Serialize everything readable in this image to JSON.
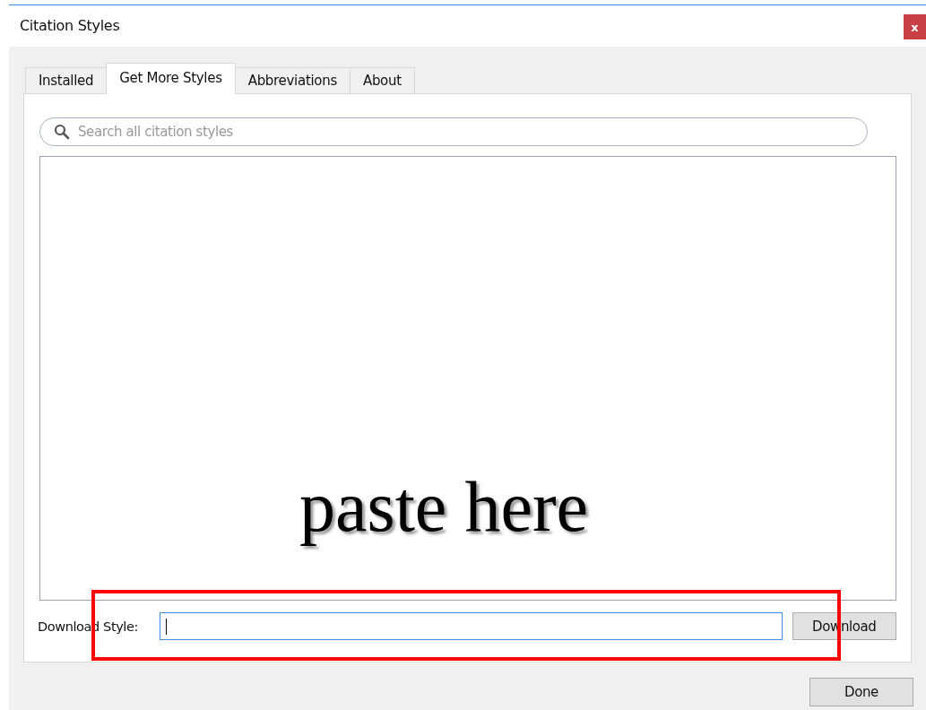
{
  "window": {
    "title": "Citation Styles",
    "close": "x"
  },
  "tabs": [
    {
      "label": "Installed",
      "selected": false
    },
    {
      "label": "Get More Styles",
      "selected": true
    },
    {
      "label": "Abbreviations",
      "selected": false
    },
    {
      "label": "About",
      "selected": false
    }
  ],
  "search": {
    "placeholder": "Search all citation styles"
  },
  "download": {
    "label": "Download Style:",
    "focused": true,
    "button": "Download"
  },
  "buttons": [
    "Done"
  ],
  "annotation": {
    "text": "paste here",
    "highlighted": true
  }
}
